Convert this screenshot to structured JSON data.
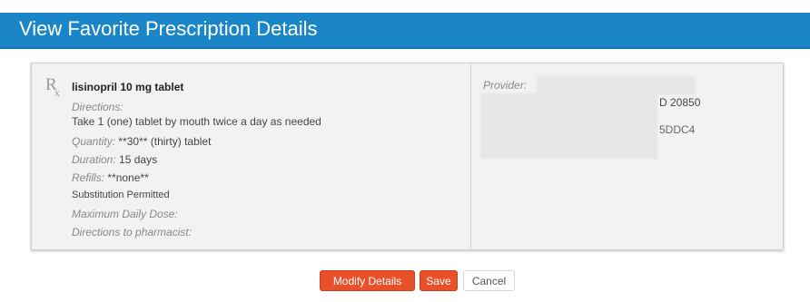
{
  "header": {
    "title": "View Favorite Prescription Details"
  },
  "prescription": {
    "drug_name": "lisinopril 10 mg tablet",
    "directions_label": "Directions:",
    "directions_value": "Take 1 (one) tablet by mouth twice a day as needed",
    "quantity_label": "Quantity:",
    "quantity_value": "**30** (thirty) tablet",
    "duration_label": "Duration:",
    "duration_value": "15 days",
    "refills_label": "Refills:",
    "refills_value": "**none**",
    "substitution": "Substitution Permitted",
    "max_daily_dose_label": "Maximum Daily Dose:",
    "pharmacist_directions_label": "Directions to pharmacist:"
  },
  "provider": {
    "label": "Provider:",
    "address_fragment_1": "D 20850",
    "address_fragment_2": "5DDC4"
  },
  "actions": {
    "modify_label": "Modify Details",
    "save_label": "Save",
    "cancel_label": "Cancel"
  },
  "colors": {
    "header_bg": "#1a86c8",
    "primary_button": "#e8502a",
    "panel_bg": "#f2f2f2"
  },
  "icons": {
    "rx": "rx-icon"
  }
}
